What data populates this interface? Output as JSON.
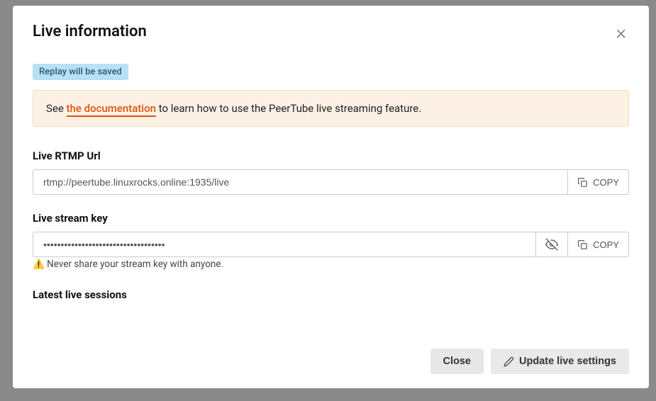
{
  "modal": {
    "title": "Live information",
    "badge": "Replay will be saved",
    "banner": {
      "prefix": "See ",
      "linkText": "the documentation",
      "suffix": " to learn how to use the PeerTube live streaming feature."
    },
    "rtmp": {
      "label": "Live RTMP Url",
      "value": "rtmp://peertube.linuxrocks.online:1935/live",
      "copy": "COPY"
    },
    "streamKey": {
      "label": "Live stream key",
      "masked": "•••••••••••••••••••••••••••••••••••",
      "copy": "COPY",
      "warning": " Never share your stream key with anyone."
    },
    "sessions": {
      "label": "Latest live sessions"
    },
    "footer": {
      "close": "Close",
      "update": "Update live settings"
    }
  }
}
